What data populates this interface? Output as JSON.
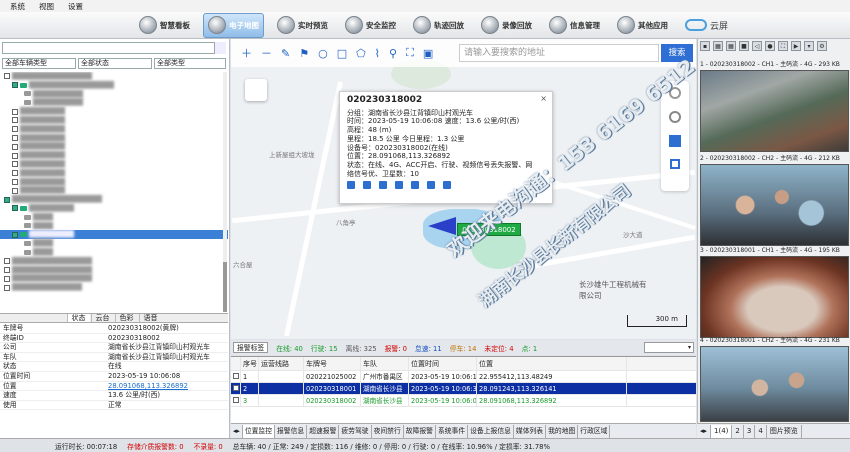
{
  "menu": [
    "系统",
    "视图",
    "设置"
  ],
  "toolbar": {
    "buttons": [
      "智慧看板",
      "电子地图",
      "实时预览",
      "安全监控",
      "轨迹回放",
      "录像回放",
      "信息管理",
      "其他应用"
    ],
    "cloud": "云屏"
  },
  "left": {
    "filters": [
      "全部车辆类型",
      "全部状态",
      "全部类型"
    ],
    "detail_tabs": [
      "状态",
      "云台",
      "色彩",
      "语音"
    ],
    "details": [
      {
        "k": "车牌号",
        "v": "020230318002(黄牌)"
      },
      {
        "k": "终端ID",
        "v": "020230318002"
      },
      {
        "k": "公司",
        "v": "湖南省长沙县江背镇印山村观光车"
      },
      {
        "k": "车队",
        "v": "湖南省长沙县江背镇印山村观光车"
      },
      {
        "k": "状态",
        "v": "在线"
      },
      {
        "k": "位置时间",
        "v": "2023-05-19 10:06:08"
      },
      {
        "k": "位置",
        "v": "28.091068,113.326892"
      },
      {
        "k": "速度",
        "v": "13.6 公里/时(西)"
      },
      {
        "k": "使用",
        "v": "正常"
      }
    ]
  },
  "map": {
    "search_placeholder": "请输入要搜索的地址",
    "search_button": "搜索",
    "scale": "300 m",
    "car_label": "020230318002",
    "labels": [
      "上新屋组大坡垅",
      "八角亭",
      "六合屋",
      "长沙雄牛工程机械有限公司",
      "沙大道"
    ],
    "popup": {
      "title": "020230318002",
      "close": "×",
      "lines": [
        "分组：湖南省长沙县江背镇印山村观光车",
        "时间：2023-05-19 10:06:08    速度：13.6 公里/时(西)",
        "高程：48 (m)",
        "里程：18.5 公里    今日里程：1.3 公里",
        "设备号：020230318002(在线)",
        "位置：28.091068,113.326892",
        "状态：在线、4G、ACC开启、行驶、视频信号丢失报警、网",
        "络信号优、卫星数：10"
      ]
    }
  },
  "list": {
    "mode": "报警标签",
    "stats": [
      {
        "label": "在线: 40",
        "color": "#1a9a2a"
      },
      {
        "label": "行驶: 15",
        "color": "#1a9a2a"
      },
      {
        "label": "离线: 325",
        "color": "#555555"
      },
      {
        "label": "报警: 0",
        "color": "#d40000"
      },
      {
        "label": "怠速: 11",
        "color": "#1a4fc0"
      },
      {
        "label": "停车: 14",
        "color": "#c07000"
      },
      {
        "label": "未定位: 4",
        "color": "#d40000"
      },
      {
        "label": "点: 1",
        "color": "#1a9a2a"
      }
    ],
    "headers": [
      "",
      "序号",
      "运营线路",
      "车牌号",
      "车队",
      "位置时间",
      "位置"
    ],
    "rows": [
      [
        "",
        "1",
        "",
        "020221025002",
        "广州市番禺区",
        "2023-05-19 10:06:17",
        "22.955412,113.48249"
      ],
      [
        "",
        "2",
        "",
        "020230318001",
        "湖南省长沙县",
        "2023-05-19 10:06:32",
        "28.091243,113.326141"
      ],
      [
        "",
        "3",
        "",
        "020230318002",
        "湖南省长沙县",
        "2023-05-19 10:06:08",
        "28.091068,113.326892"
      ]
    ],
    "tabs": [
      "位置监控",
      "报警信息",
      "超速报警",
      "疲劳驾驶",
      "夜间禁行",
      "故障报警",
      "系统事件",
      "设备上报信息",
      "媒体列表",
      "我的地图",
      "行政区域"
    ]
  },
  "video": {
    "channels": [
      "1 - 020230318002 - CH1 - 主码流 - 4G - 293 KB",
      "2 - 020230318002 - CH2 - 主码流 - 4G - 212 KB",
      "3 - 020230318001 - CH1 - 主码流 - 4G - 195 KB",
      "4 - 020230318001 - CH2 - 主码流 - 4G - 231 KB"
    ],
    "tabs": [
      "1(4)",
      "2",
      "3",
      "4",
      "图片预览"
    ]
  },
  "status": {
    "runtime": "运行时长: 00:07:18",
    "alarm": "存储介质报警数: 0",
    "unhandled": "不录量: 0",
    "totals": "总车辆: 40 / 正常: 249 / 定损数: 116 / 维修: 0 / 停用: 0 / 行驶: 0 / 在线率: 10.96% / 定损率: 31.78%"
  },
  "watermark": [
    "欢迎来电沟通：153 6169 6512",
    "湖南长沙县长新有限公司"
  ]
}
